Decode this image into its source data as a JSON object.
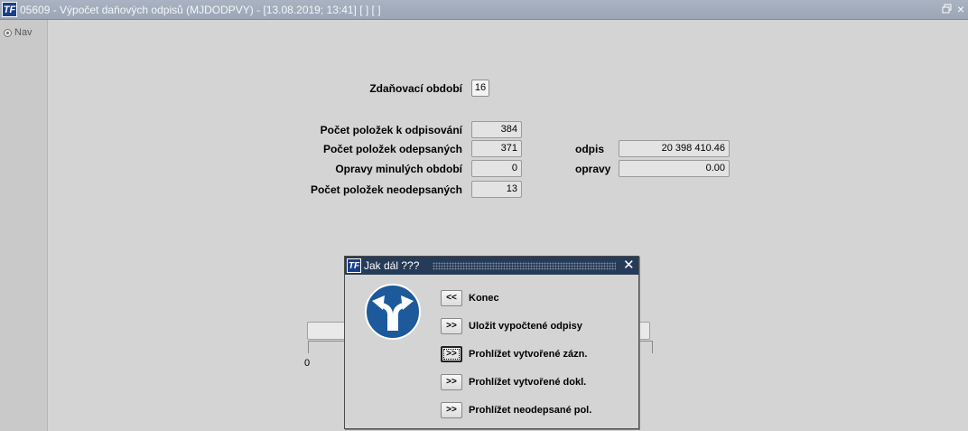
{
  "window": {
    "app_icon": "TF",
    "title": "05609 - Výpočet daňových odpisů (MJDODPVY) - [13.08.2019; 13:41]  [ ]  [ ]",
    "restore_icon": "restore-icon",
    "close_symbol": "×"
  },
  "nav": {
    "label": "Nav"
  },
  "form": {
    "period_label": "Zdaňovací období",
    "period_value": "16",
    "rows": [
      {
        "label": "Počet položek k odpisování",
        "value": "384"
      },
      {
        "label": "Počet položek odepsaných",
        "value": "371"
      },
      {
        "label": "Opravy minulých období",
        "value": "0"
      },
      {
        "label": "Počet položek neodepsaných",
        "value": "13"
      }
    ],
    "odpis_label": "odpis",
    "odpis_value": "20 398 410.46",
    "opravy_label": "opravy",
    "opravy_value": "0.00",
    "progress_zero": "0"
  },
  "dialog": {
    "app_icon": "TF",
    "title": "Jak dál ???",
    "close_symbol": "✕",
    "sign_icon": "direction-sign-icon",
    "actions": [
      {
        "button": "<<",
        "label": "Konec"
      },
      {
        "button": ">>",
        "label": "Uložit vypočtené odpisy"
      },
      {
        "button": ">>",
        "label": "Prohlížet vytvořené zázn."
      },
      {
        "button": ">>",
        "label": "Prohlížet vytvořené dokl."
      },
      {
        "button": ">>",
        "label": "Prohlížet neodepsané pol."
      }
    ]
  },
  "colors": {
    "title_bar": "#9ba6b6",
    "dialog_title_bar": "#263b57",
    "sign_blue": "#1c5a9c"
  }
}
